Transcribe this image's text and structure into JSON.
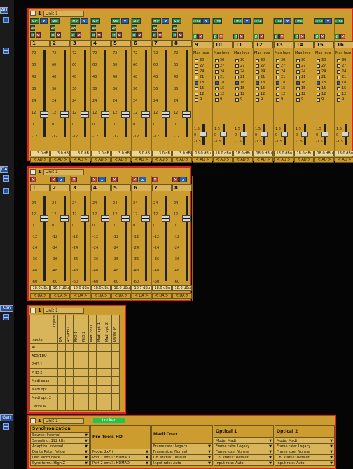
{
  "sidebar": {
    "ad": "AD",
    "da": "DA",
    "con": "Con",
    "gen": "Gen"
  },
  "ad": {
    "unit_num": "1",
    "unit_name": "Unit 1",
    "channels": [
      {
        "num": "1",
        "b1": "Mic",
        "b2": "48",
        "b3": "Ø",
        "val": "3.0 dB",
        "io": "< AD >"
      },
      {
        "num": "2",
        "b1": "Mic",
        "b2": "48",
        "b3": "Ø",
        "val": "3.0 dB",
        "io": "< AD >"
      },
      {
        "num": "3",
        "b1": "Mic",
        "b2": "48",
        "b3": "Ø",
        "val": "3.0 dB",
        "io": "< AD >"
      },
      {
        "num": "4",
        "b1": "Mic",
        "b2": "48",
        "b3": "Ø",
        "val": "3.0 dB",
        "io": "< AD >"
      },
      {
        "num": "5",
        "b1": "Mic",
        "b2": "48",
        "b3": "Ø",
        "val": "3.0 dB",
        "io": "< AD >"
      },
      {
        "num": "6",
        "b1": "Mic",
        "b2": "48",
        "b3": "Ø",
        "val": "3.0 dB",
        "io": "< AD >"
      },
      {
        "num": "7",
        "b1": "Mic",
        "b2": "48",
        "b3": "Ø",
        "val": "3.0 dB",
        "io": "< AD >"
      },
      {
        "num": "8",
        "b1": "Mic",
        "b2": "48",
        "b3": "Ø",
        "val": "3.0 dB",
        "io": "< AD >"
      },
      {
        "num": "9",
        "b1": "Line",
        "b2": "",
        "b3": "Ø",
        "val": "18.0 dBu",
        "io": "< AD >"
      },
      {
        "num": "10",
        "b1": "Line",
        "b2": "",
        "b3": "Ø",
        "val": "18.0 dBu",
        "io": "< AD >"
      },
      {
        "num": "11",
        "b1": "Line",
        "b2": "",
        "b3": "Ø",
        "val": "18.0 dBu",
        "io": "< AD >"
      },
      {
        "num": "12",
        "b1": "Line",
        "b2": "",
        "b3": "Ø",
        "val": "18.0 dBu",
        "io": "< AD >"
      },
      {
        "num": "13",
        "b1": "Line",
        "b2": "",
        "b3": "Ø",
        "val": "18.0 dBu",
        "io": "< AD >"
      },
      {
        "num": "14",
        "b1": "Line",
        "b2": "",
        "b3": "Ø",
        "val": "18.0 dBu",
        "io": "< AD >"
      },
      {
        "num": "15",
        "b1": "Line",
        "b2": "",
        "b3": "Ø",
        "val": "18.0 dBu",
        "io": "< AD >"
      },
      {
        "num": "16",
        "b1": "Line",
        "b2": "",
        "b3": "Ø",
        "val": "18.0 dBu",
        "io": "< AD >"
      }
    ],
    "mic_scale": [
      "72",
      "60",
      "48",
      "36",
      "24",
      "12",
      "0",
      "-12"
    ],
    "max_level_label": "Max leve",
    "max_levels": [
      "30",
      "27",
      "24",
      "21",
      "18",
      "15",
      "12",
      "9"
    ],
    "trim_labels": [
      "1.5",
      "0",
      "-1.5"
    ]
  },
  "da": {
    "unit_num": "1",
    "unit_name": "Unit 1",
    "channels": [
      {
        "num": "1",
        "val": "18.0 dBu",
        "io": "< DA >"
      },
      {
        "num": "2",
        "val": "16.9 dBu",
        "io": "< DA >"
      },
      {
        "num": "3",
        "val": "18.0 dBu",
        "io": "< DA >"
      },
      {
        "num": "4",
        "val": "18.0 dBu",
        "io": "< DA >"
      },
      {
        "num": "5",
        "val": "18.0 dBu",
        "io": "< DA >"
      },
      {
        "num": "6",
        "val": "16.7 dBu",
        "io": "< DA >"
      },
      {
        "num": "7",
        "val": "18.0 dBu",
        "io": "< DA >"
      },
      {
        "num": "8",
        "val": "18.0 dBu",
        "io": "< DA >"
      }
    ],
    "scale": [
      "24",
      "12",
      "0",
      "-12",
      "-24",
      "-36",
      "-48",
      "-60"
    ]
  },
  "con": {
    "unit_num": "1",
    "unit_name": "Unit 1",
    "outputs_label": "Outputs",
    "inputs_label": "Inputs",
    "outputs": [
      "DA",
      "AES/EBU",
      "PHD 1",
      "PHD 2",
      "Madi coax",
      "Madi opt. 1",
      "Madi opt. 2",
      "Dante IP"
    ],
    "inputs": [
      "AD",
      "AES/EBU",
      "PHD 1",
      "PHD 2",
      "Madi coax",
      "Madi opt. 1",
      "Madi opt. 2",
      "Dante IP"
    ]
  },
  "gen": {
    "unit_num": "1",
    "unit_name": "Unit 1",
    "status": "Locked",
    "columns": [
      {
        "title": "Synchronization",
        "rows": [
          "Source: Internal",
          "Sampling: 192 kHz",
          "Adapt to: Internal",
          "Dante Rate: Follow",
          "Out: Word clock",
          "Sync.term.: High Z"
        ]
      },
      {
        "title": "Pro Tools HD",
        "rows": [
          "Mode: 2xPri",
          "Port 1 emul.: HDMADI",
          "Port 2 emul.: HDMADI"
        ]
      },
      {
        "title": "Madi Coax",
        "rows": [
          "Frame rate: Legacy",
          "Frame size: Normal",
          "Ch. status: Default",
          "Input rate: Auto"
        ]
      },
      {
        "title": "Optical 1",
        "rows": [
          "Mode: Madi",
          "Frame rate: Legacy",
          "Frame size: Normal",
          "Ch. status: Default",
          "Input rate: Auto"
        ]
      },
      {
        "title": "Optical 2",
        "rows": [
          "Mode: Madi",
          "Frame rate: Legacy",
          "Frame size: Normal",
          "Ch. status: Default",
          "Input rate: Auto"
        ]
      }
    ]
  },
  "colors": {
    "panel": "#cc9d2e",
    "frame": "#e02020",
    "background": "#050505"
  }
}
